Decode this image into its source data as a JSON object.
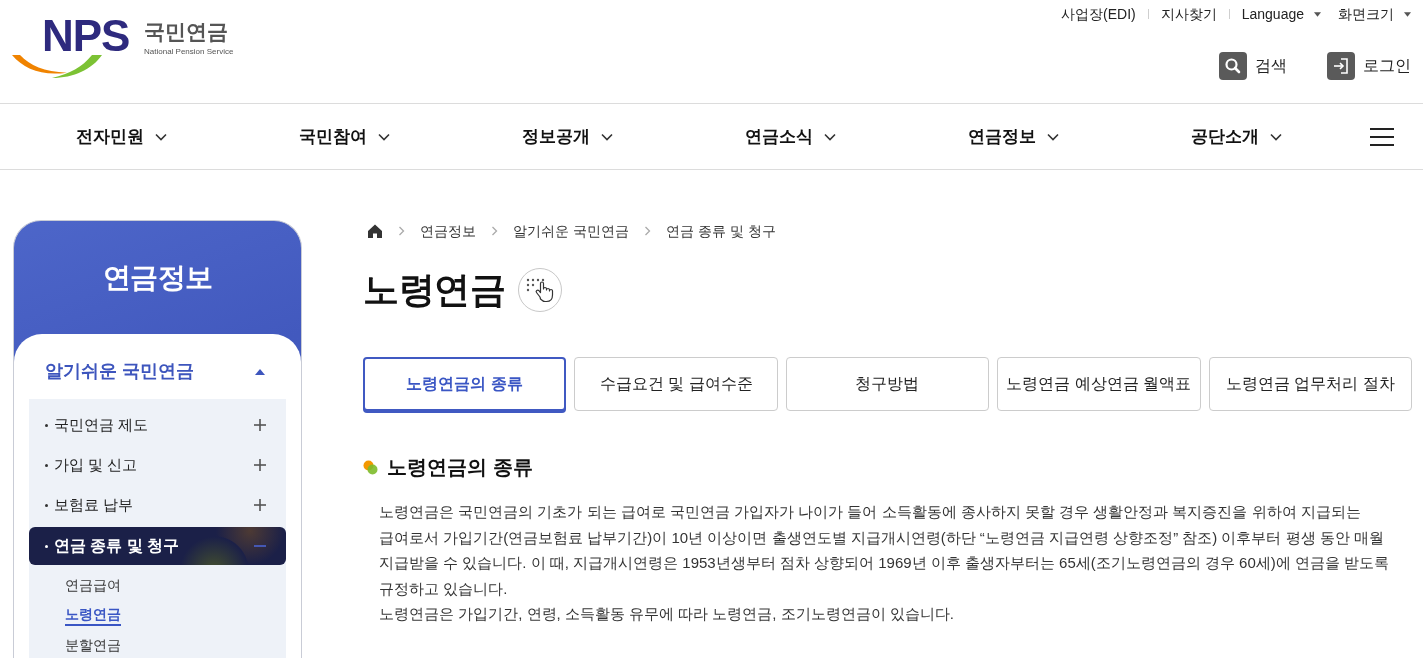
{
  "header": {
    "logo": {
      "letters": "NPS",
      "name": "국민연금",
      "tagline": "National Pension Service"
    },
    "utility_links": [
      {
        "label": "사업장(EDI)",
        "dropdown": false
      },
      {
        "label": "지사찾기",
        "dropdown": false
      },
      {
        "label": "Language",
        "dropdown": true
      },
      {
        "label": "화면크기",
        "dropdown": true
      }
    ],
    "actions": [
      {
        "kind": "search",
        "label": "검색"
      },
      {
        "kind": "login",
        "label": "로그인"
      }
    ]
  },
  "nav": {
    "items": [
      "전자민원",
      "국민참여",
      "정보공개",
      "연금소식",
      "연금정보",
      "공단소개"
    ]
  },
  "sidebar": {
    "title": "연금정보",
    "section": {
      "label": "알기쉬운 국민연금",
      "expanded": true
    },
    "items": [
      {
        "label": "국민연금 제도",
        "expanded": false,
        "selected": false
      },
      {
        "label": "가입 및 신고",
        "expanded": false,
        "selected": false
      },
      {
        "label": "보험료 납부",
        "expanded": false,
        "selected": false
      },
      {
        "label": "연금 종류 및 청구",
        "expanded": true,
        "selected": true,
        "children": [
          {
            "label": "연금급여",
            "selected": false
          },
          {
            "label": "노령연금",
            "selected": true
          },
          {
            "label": "분할연금",
            "selected": false
          }
        ]
      }
    ]
  },
  "breadcrumb": [
    "연금정보",
    "알기쉬운 국민연금",
    "연금 종류 및 청구"
  ],
  "page_title": "노령연금",
  "tabs": [
    {
      "label": "노령연금의 종류",
      "selected": true
    },
    {
      "label": "수급요건 및 급여수준",
      "selected": false
    },
    {
      "label": "청구방법",
      "selected": false
    },
    {
      "label": "노령연금 예상연금 월액표",
      "selected": false
    },
    {
      "label": "노령연금 업무처리 절차",
      "selected": false
    }
  ],
  "content": {
    "heading": "노령연금의 종류",
    "paragraphs": [
      "노령연금은 국민연금의 기초가 되는 급여로 국민연금 가입자가 나이가 들어 소득활동에 종사하지 못할 경우 생활안정과 복지증진을 위하여 지급되는 급여로서 가입기간(연금보험료 납부기간)이 10년 이상이면 출생연도별 지급개시연령(하단 “노령연금 지급연령 상향조정” 참조) 이후부터 평생 동안 매월 지급받을 수 있습니다. 이 때, 지급개시연령은 1953년생부터 점차 상향되어 1969년 이후 출생자부터는 65세(조기노령연금의 경우 60세)에 연금을 받도록 규정하고 있습니다.",
      "노령연금은 가입기간, 연령, 소득활동 유무에 따라 노령연금, 조기노령연금이 있습니다."
    ]
  }
}
